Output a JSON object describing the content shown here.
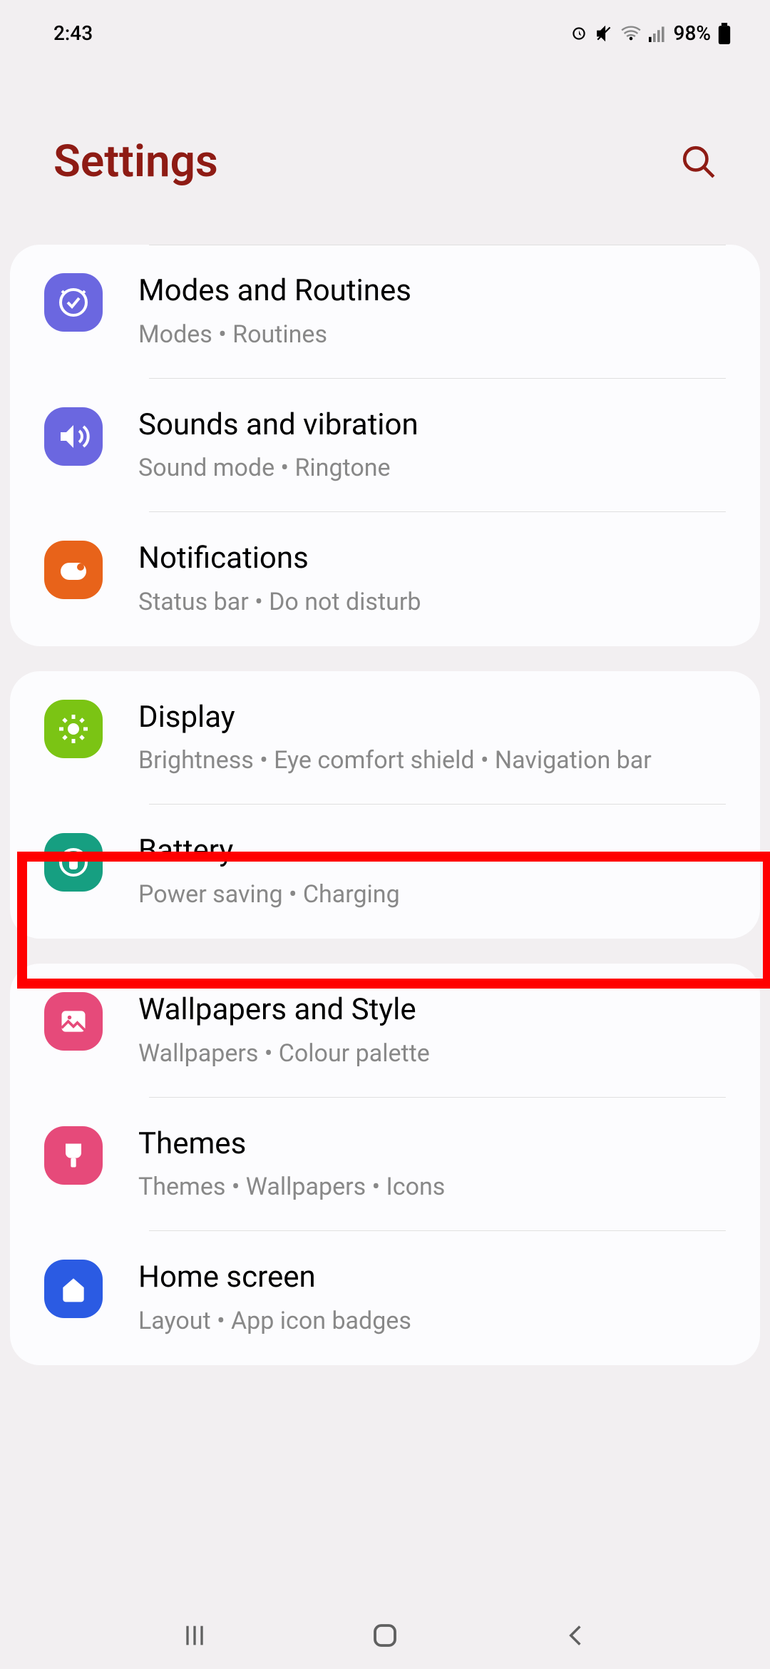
{
  "statusbar": {
    "time": "2:43",
    "battery_pct": "98%"
  },
  "header": {
    "title": "Settings"
  },
  "groups": [
    {
      "items": [
        {
          "title": "Modes and Routines",
          "sub": "Modes  •  Routines",
          "icon": "modes",
          "bg": "purple"
        },
        {
          "title": "Sounds and vibration",
          "sub": "Sound mode  •  Ringtone",
          "icon": "sound",
          "bg": "purple"
        },
        {
          "title": "Notifications",
          "sub": "Status bar  •  Do not disturb",
          "icon": "notif",
          "bg": "orange"
        }
      ]
    },
    {
      "items": [
        {
          "title": "Display",
          "sub": "Brightness  •  Eye comfort shield  •  Navigation bar",
          "icon": "display",
          "bg": "green"
        },
        {
          "title": "Battery",
          "sub": "Power saving  •  Charging",
          "icon": "battery",
          "bg": "teal",
          "highlight": true
        }
      ]
    },
    {
      "items": [
        {
          "title": "Wallpapers and Style",
          "sub": "Wallpapers  •  Colour palette",
          "icon": "wallpaper",
          "bg": "pink"
        },
        {
          "title": "Themes",
          "sub": "Themes  •  Wallpapers  •  Icons",
          "icon": "themes",
          "bg": "pink"
        },
        {
          "title": "Home screen",
          "sub": "Layout  •  App icon badges",
          "icon": "home",
          "bg": "blue"
        }
      ]
    }
  ]
}
